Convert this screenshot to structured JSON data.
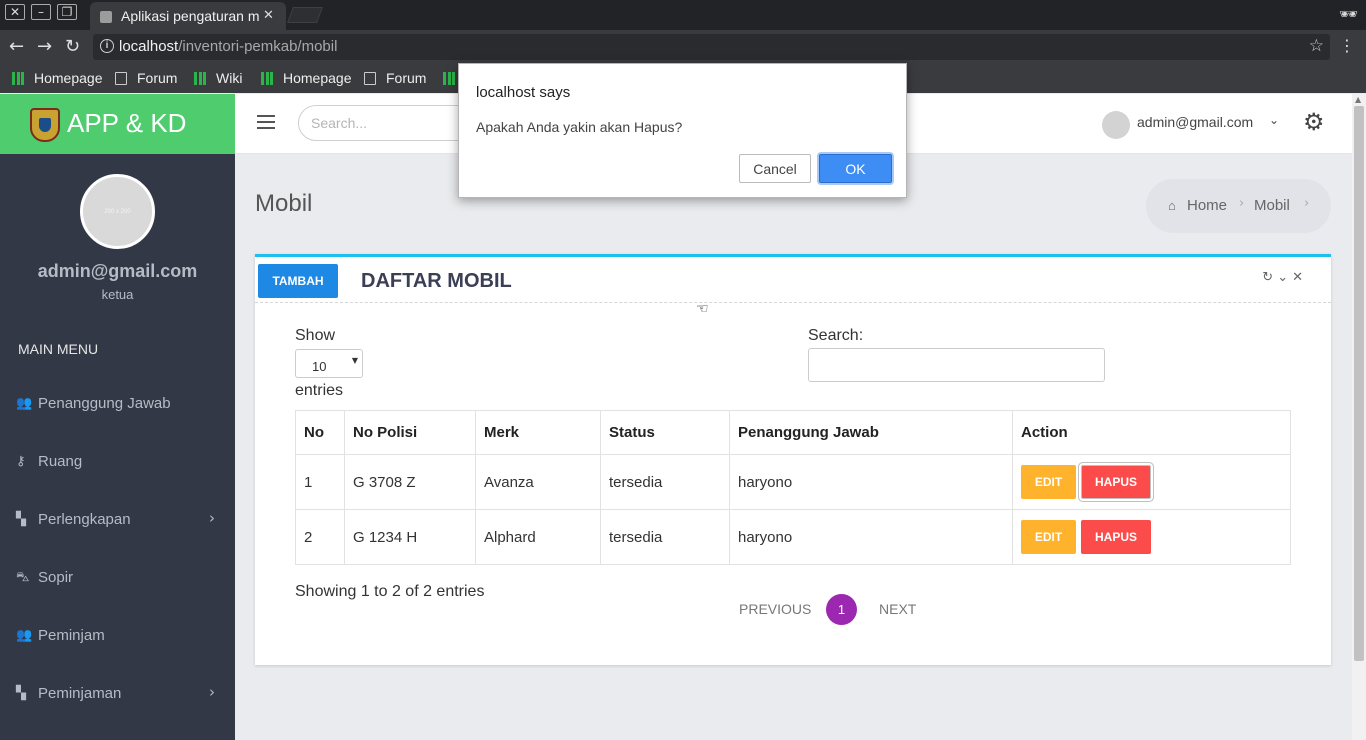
{
  "browser": {
    "tab_title": "Aplikasi pengaturan m",
    "url_host": "localhost",
    "url_path": "/inventori-pemkab/mobil",
    "bookmarks": [
      {
        "label": "Homepage",
        "icon": "green-bars-icon"
      },
      {
        "label": "Forum",
        "icon": "page-icon"
      },
      {
        "label": "Wiki",
        "icon": "green-bars-icon"
      },
      {
        "label": "Homepage",
        "icon": "green-bars-icon"
      },
      {
        "label": "Forum",
        "icon": "page-icon"
      }
    ]
  },
  "brand": {
    "name": "APP & KD"
  },
  "user": {
    "avatar_text": "200 x 200",
    "email": "admin@gmail.com",
    "role": "ketua"
  },
  "sidebar": {
    "menu_title": "MAIN MENU",
    "items": [
      {
        "label": "Penanggung Jawab",
        "icon": "people-icon",
        "has_submenu": false
      },
      {
        "label": "Ruang",
        "icon": "key-icon",
        "has_submenu": false
      },
      {
        "label": "Perlengkapan",
        "icon": "widgets-icon",
        "has_submenu": true
      },
      {
        "label": "Sopir",
        "icon": "car-icon",
        "has_submenu": false
      },
      {
        "label": "Peminjam",
        "icon": "people-icon",
        "has_submenu": false
      },
      {
        "label": "Peminjaman",
        "icon": "widgets-icon",
        "has_submenu": true
      }
    ]
  },
  "topbar": {
    "search_placeholder": "Search...",
    "user_email": "admin@gmail.com"
  },
  "page": {
    "title": "Mobil",
    "breadcrumb": [
      "Home",
      "Mobil"
    ]
  },
  "card": {
    "add_button": "TAMBAH",
    "title": "DAFTAR MOBIL",
    "show_label": "Show",
    "entries_label": "entries",
    "page_length": "10",
    "search_label": "Search:",
    "columns": [
      "No",
      "No Polisi",
      "Merk",
      "Status",
      "Penanggung Jawab",
      "Action"
    ],
    "rows": [
      {
        "no": "1",
        "polisi": "G 3708 Z",
        "merk": "Avanza",
        "status": "tersedia",
        "pj": "haryono"
      },
      {
        "no": "2",
        "polisi": "G 1234 H",
        "merk": "Alphard",
        "status": "tersedia",
        "pj": "haryono"
      }
    ],
    "edit_label": "EDIT",
    "delete_label": "HAPUS",
    "info": "Showing 1 to 2 of 2 entries",
    "prev_label": "PREVIOUS",
    "current_page": "1",
    "next_label": "NEXT"
  },
  "dialog": {
    "title": "localhost says",
    "message": "Apakah Anda yakin akan Hapus?",
    "cancel_label": "Cancel",
    "ok_label": "OK"
  },
  "colors": {
    "brand_green": "#4fcd6e",
    "sidebar_bg": "#333846",
    "accent_blue": "#1e88e5",
    "edit_orange": "#ffb22b",
    "delete_red": "#fc4b4b",
    "page_purple": "#9c27b0",
    "card_border": "#1ebfee"
  }
}
